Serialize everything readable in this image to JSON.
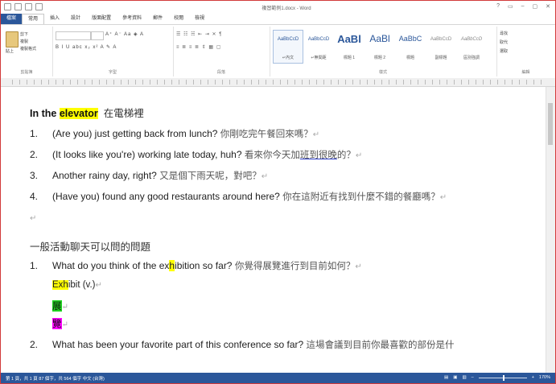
{
  "window": {
    "title": "複習範例1.docx - Word",
    "controls": [
      "?",
      "▭",
      "–",
      "▢",
      "✕"
    ]
  },
  "tabs": [
    {
      "label": "檔案"
    },
    {
      "label": "常用"
    },
    {
      "label": "插入"
    },
    {
      "label": "設計"
    },
    {
      "label": "版面配置"
    },
    {
      "label": "參考資料"
    },
    {
      "label": "郵件"
    },
    {
      "label": "校閱"
    },
    {
      "label": "檢視"
    }
  ],
  "ribbon": {
    "clipboard": {
      "paste": "貼上",
      "cut": "剪下",
      "copy": "複製",
      "format": "複製格式",
      "label": "剪貼簿"
    },
    "font": {
      "label": "字型",
      "row1": "A⁺ A⁻ Aa ◈ A",
      "row2": "B I U abc x₂ x² A ✎ A"
    },
    "paragraph": {
      "label": "段落",
      "row1": "☰ ☷ ☵ ⇤ ⇥ ✕ ¶",
      "row2": "≡ ≣ ≡ ≣ ⇕ ▦ ▢"
    },
    "styles": {
      "label": "樣式",
      "items": [
        {
          "preview": "AaBbCcD",
          "name": "↵內文"
        },
        {
          "preview": "AaBbCcD",
          "name": "↵無間距"
        },
        {
          "preview": "AaBl",
          "name": "標題 1"
        },
        {
          "preview": "AaBl",
          "name": "標題 2"
        },
        {
          "preview": "AaBbC",
          "name": "標題"
        },
        {
          "preview": "AaBbCcD",
          "name": "副標題"
        },
        {
          "preview": "AaBbCcD",
          "name": "區別強調"
        }
      ]
    },
    "editing": {
      "label": "編輯",
      "find": "尋找",
      "replace": "取代",
      "select": "選取"
    }
  },
  "document": {
    "heading": {
      "pre": "In the ",
      "highlight": "elevator",
      "cjk": "在電梯裡"
    },
    "items1": [
      {
        "num": "1.",
        "en": "(Are you) just getting back from lunch?",
        "zh": "你剛吃完午餐回來嗎？"
      },
      {
        "num": "2.",
        "en": "(It looks like you're) working late today, huh?",
        "zh_pre": "看來你今天加",
        "zh_ul": "班到很晚",
        "zh_post": "的？"
      },
      {
        "num": "3.",
        "en": "Another rainy day, right?",
        "zh": "又是個下雨天呢，對吧？"
      },
      {
        "num": "4.",
        "en": "(Have you) found any good restaurants around here?",
        "zh": "你在這附近有找到什麼不錯的餐廳嗎？"
      }
    ],
    "section2_title": "一般活動聊天可以問的問題",
    "q1": {
      "num": "1.",
      "en_pre": "What do you think of the ex",
      "en_hl": "h",
      "en_post": "ibition so far?",
      "zh": "你覺得展覽進行到目前如何？"
    },
    "vocab": {
      "hl": "Exh",
      "rest": "ibit (v.)",
      "a": "展",
      "b": "覽"
    },
    "q2": {
      "num": "2.",
      "en": "What has been your favorite part of this conference so far?",
      "zh": "這場會議到目前你最喜歡的部份是什"
    }
  },
  "status": {
    "left": "第 1 頁，共 1 頁    87 個字，共 564 個字    中文 (台灣)",
    "zoom": "170%"
  }
}
